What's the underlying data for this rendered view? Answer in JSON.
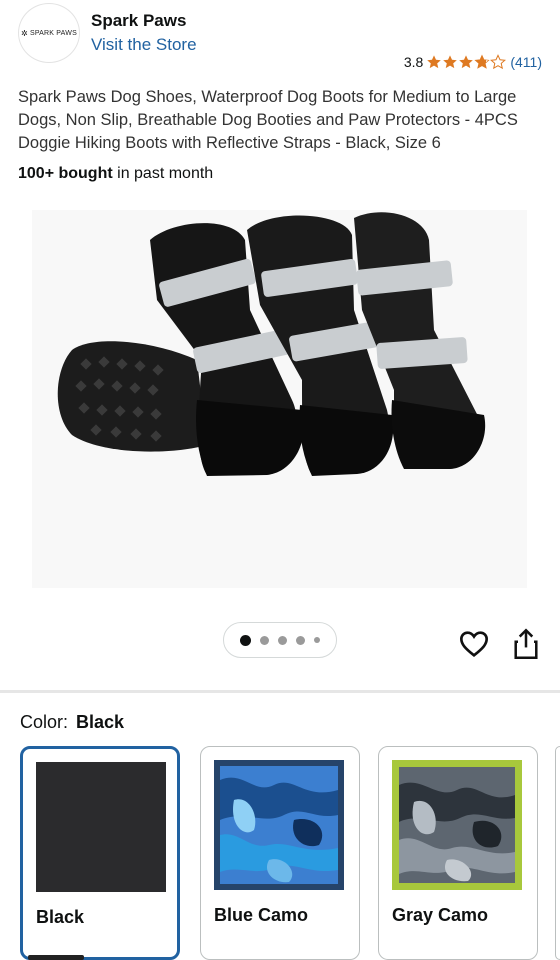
{
  "brand": {
    "logo_text": "SPARK PAWS",
    "name": "Spark Paws",
    "visit_store": "Visit the Store"
  },
  "rating": {
    "value": "3.8",
    "stars": 3.8,
    "count": "(411)",
    "star_color": "#de7921"
  },
  "product": {
    "title": "Spark Paws Dog Shoes, Waterproof Dog Boots for Medium to Large Dogs, Non Slip, Breathable Dog Booties and Paw Protectors - 4PCS Doggie Hiking Boots with Reflective Straps - Black, Size 6",
    "bought_bold": "100+ bought",
    "bought_rest": " in past month"
  },
  "carousel": {
    "total_dots": 5,
    "active_index": 0
  },
  "color_selector": {
    "label": "Color:",
    "selected": "Black",
    "options": [
      {
        "name": "Black",
        "selected": true
      },
      {
        "name": "Blue Camo",
        "selected": false
      },
      {
        "name": "Gray Camo",
        "selected": false
      }
    ]
  },
  "colors": {
    "link": "#2162a1",
    "selected_border": "#2162a1",
    "gray_camo_frame": "#a8c83c"
  },
  "icons": {
    "favorite": "heart-icon",
    "share": "share-icon"
  }
}
